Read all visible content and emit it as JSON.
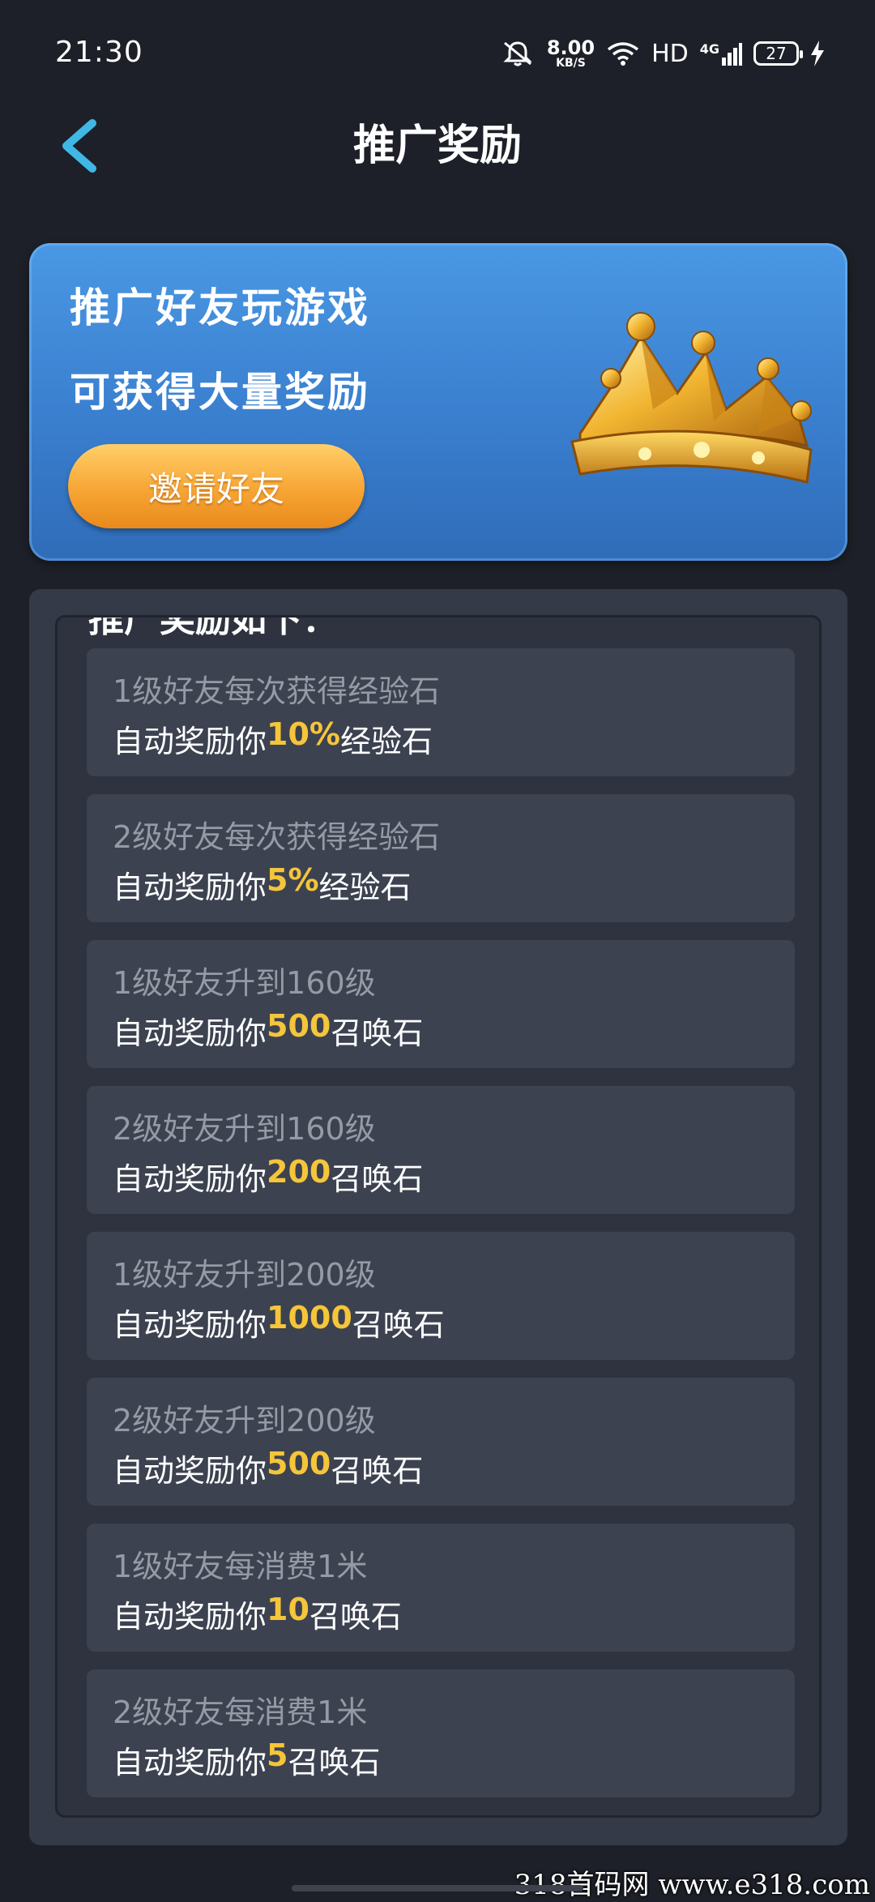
{
  "status_bar": {
    "time": "21:30",
    "net_speed_value": "8.00",
    "net_speed_unit": "KB/S",
    "hd_label": "HD",
    "network_label": "4G",
    "battery": "27"
  },
  "header": {
    "title": "推广奖励"
  },
  "banner": {
    "line1": "推广好友玩游戏",
    "line2": "可获得大量奖励",
    "invite_button": "邀请好友"
  },
  "rewards": {
    "heading": "推广奖励如下：",
    "items": [
      {
        "condition": "1级好友每次获得经验石",
        "prefix": "自动奖励你",
        "amount": "10%",
        "suffix": "经验石"
      },
      {
        "condition": "2级好友每次获得经验石",
        "prefix": "自动奖励你",
        "amount": "5%",
        "suffix": "经验石"
      },
      {
        "condition": "1级好友升到160级",
        "prefix": "自动奖励你",
        "amount": "500",
        "suffix": "召唤石"
      },
      {
        "condition": "2级好友升到160级",
        "prefix": "自动奖励你",
        "amount": "200",
        "suffix": "召唤石"
      },
      {
        "condition": "1级好友升到200级",
        "prefix": "自动奖励你",
        "amount": "1000",
        "suffix": "召唤石"
      },
      {
        "condition": "2级好友升到200级",
        "prefix": "自动奖励你",
        "amount": "500",
        "suffix": "召唤石"
      },
      {
        "condition": "1级好友每消费1米",
        "prefix": "自动奖励你",
        "amount": "10",
        "suffix": "召唤石"
      },
      {
        "condition": "2级好友每消费1米",
        "prefix": "自动奖励你",
        "amount": "5",
        "suffix": "召唤石"
      }
    ]
  },
  "watermark": "318首码网  www.e318.com",
  "colors": {
    "background": "#1d2028",
    "accent_back": "#3fb8e6",
    "banner_blue": "#3a7fcf",
    "button_orange": "#f7a534",
    "amount_gold": "#f5c53a"
  }
}
